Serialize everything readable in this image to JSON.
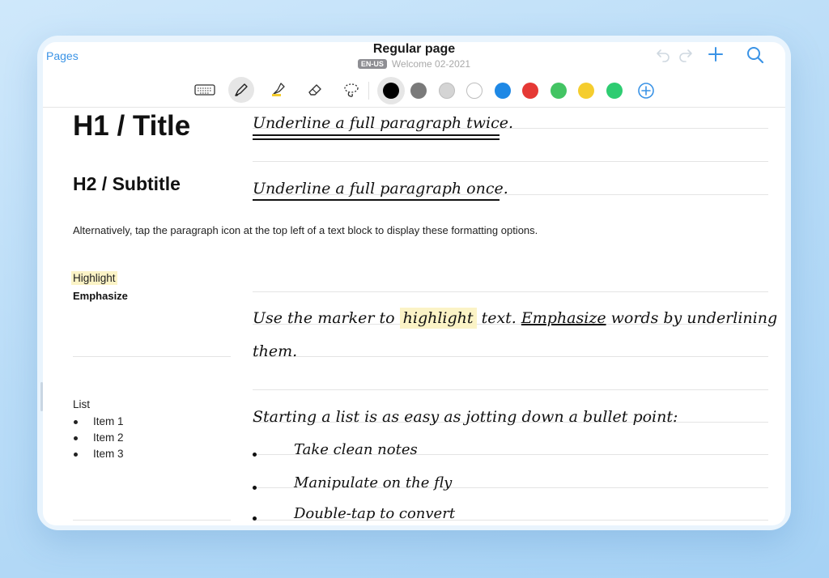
{
  "header": {
    "pages_label": "Pages",
    "title": "Regular page",
    "language_badge": "EN-US",
    "notebook_name": "Welcome 02-2021"
  },
  "toolbar": {
    "tools": [
      "keyboard-icon",
      "pen-icon",
      "highlighter-icon",
      "eraser-icon",
      "lasso-icon"
    ],
    "active_tool": "pen-icon",
    "swatches": [
      "#000000",
      "#7a7a7a",
      "#d4d4d4",
      "#ffffff",
      "#1e88e5",
      "#e53935",
      "#43c463",
      "#f5cd2e",
      "#2ecc71"
    ],
    "selected_swatch": "#000000",
    "accent": "#3a93e6"
  },
  "typed": {
    "h1": "H1 / Title",
    "h2": "H2 / Subtitle",
    "body": "Alternatively, tap the paragraph icon at the top left of a text block to display these formatting options.",
    "highlight": "Highlight",
    "emphasize": "Emphasize",
    "list_heading": "List",
    "list_items": [
      "Item 1",
      "Item 2",
      "Item 3"
    ]
  },
  "handwriting": {
    "line1": "Underline a full paragraph twice.",
    "line2": "Underline a full paragraph once.",
    "line3_pre": "Use the marker to ",
    "line3_highlight": "highlight",
    "line3_mid": " text. ",
    "line3_emph": "Emphasize",
    "line3_post": " words by underlining",
    "line3b": "them.",
    "line4": "Starting a list is as easy as jotting down a bullet point:",
    "items": [
      "Take clean notes",
      "Manipulate on the fly",
      "Double-tap to convert"
    ]
  }
}
